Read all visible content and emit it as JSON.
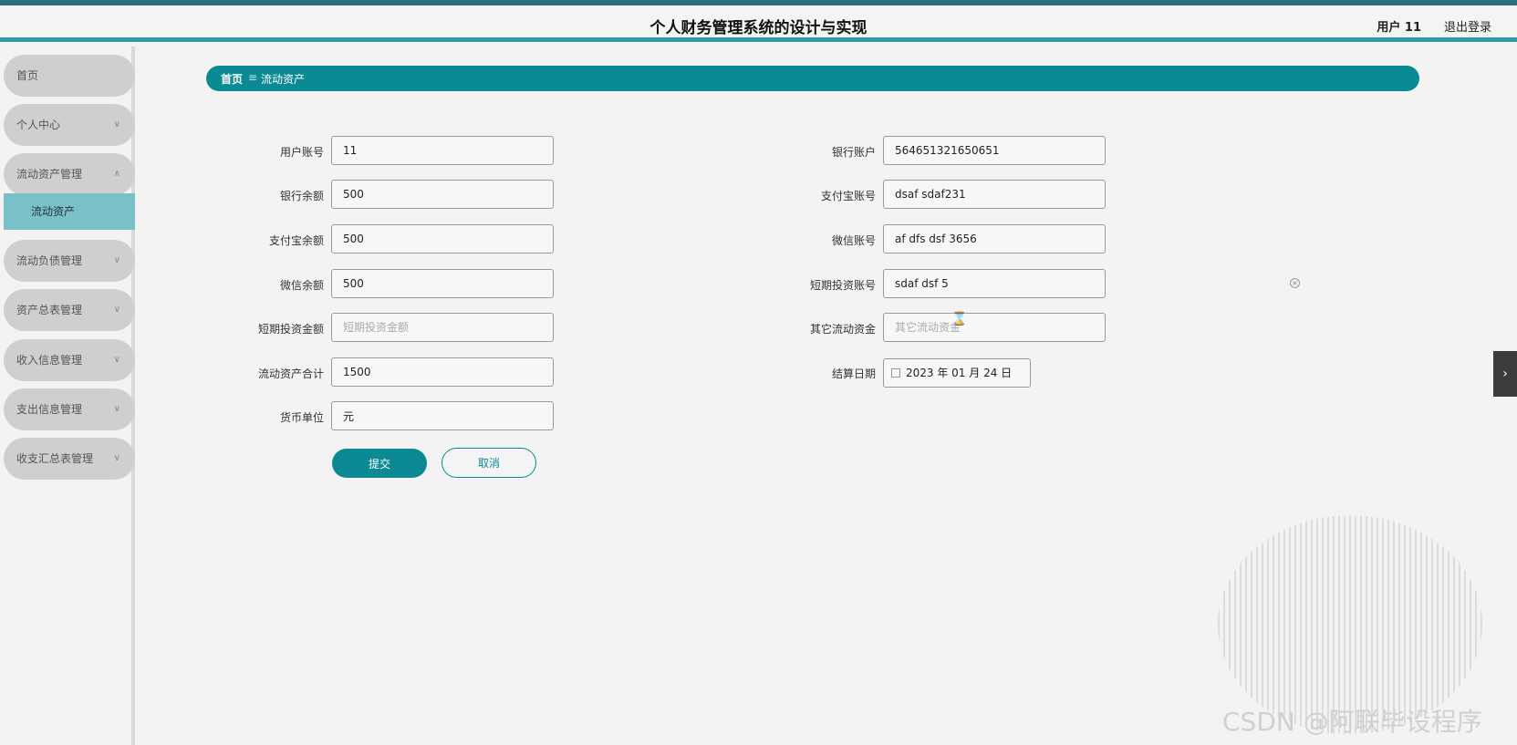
{
  "header": {
    "title": "个人财务管理系统的设计与实现",
    "user": "用户 11",
    "logout": "退出登录"
  },
  "sidebar": {
    "items": [
      {
        "label": "首页"
      },
      {
        "label": "个人中心",
        "icon": "chevron-down-icon"
      },
      {
        "label": "流动资产管理",
        "icon": "chevron-up-icon"
      },
      {
        "label": "流动负债管理",
        "icon": "chevron-down-icon"
      },
      {
        "label": "资产总表管理",
        "icon": "chevron-down-icon"
      },
      {
        "label": "收入信息管理",
        "icon": "chevron-down-icon"
      },
      {
        "label": "支出信息管理",
        "icon": "chevron-down-icon"
      },
      {
        "label": "收支汇总表管理",
        "icon": "chevron-down-icon"
      }
    ],
    "sub_active": "流动资产"
  },
  "breadcrumb": {
    "home": "首页",
    "current": "流动资产"
  },
  "form": {
    "left": [
      {
        "label": "用户账号",
        "value": "11",
        "placeholder": ""
      },
      {
        "label": "银行余额",
        "value": "500",
        "placeholder": ""
      },
      {
        "label": "支付宝余额",
        "value": "500",
        "placeholder": ""
      },
      {
        "label": "微信余额",
        "value": "500",
        "placeholder": ""
      },
      {
        "label": "短期投资金额",
        "value": "",
        "placeholder": "短期投资金额"
      },
      {
        "label": "流动资产合计",
        "value": "1500",
        "placeholder": ""
      },
      {
        "label": "货币单位",
        "value": "元",
        "placeholder": ""
      }
    ],
    "right": [
      {
        "label": "银行账户",
        "value": "564651321650651",
        "placeholder": ""
      },
      {
        "label": "支付宝账号",
        "value": "dsaf sdaf231",
        "placeholder": ""
      },
      {
        "label": "微信账号",
        "value": "af dfs dsf 3656",
        "placeholder": ""
      },
      {
        "label": "短期投资账号",
        "value": "sdaf dsf 5",
        "placeholder": ""
      },
      {
        "label": "其它流动资金",
        "value": "",
        "placeholder": "其它流动资金"
      },
      {
        "label": "结算日期",
        "value": "2023 年 01 月 24 日"
      }
    ],
    "submit": "提交",
    "cancel": "取消"
  },
  "watermark": "CSDN @阿联毕设程序",
  "colors": {
    "accent": "#0b8a94",
    "header_bar": "#2e9aa4",
    "sub_active_bg": "#7bbfc7",
    "nav_bg": "#cfcfcf"
  }
}
